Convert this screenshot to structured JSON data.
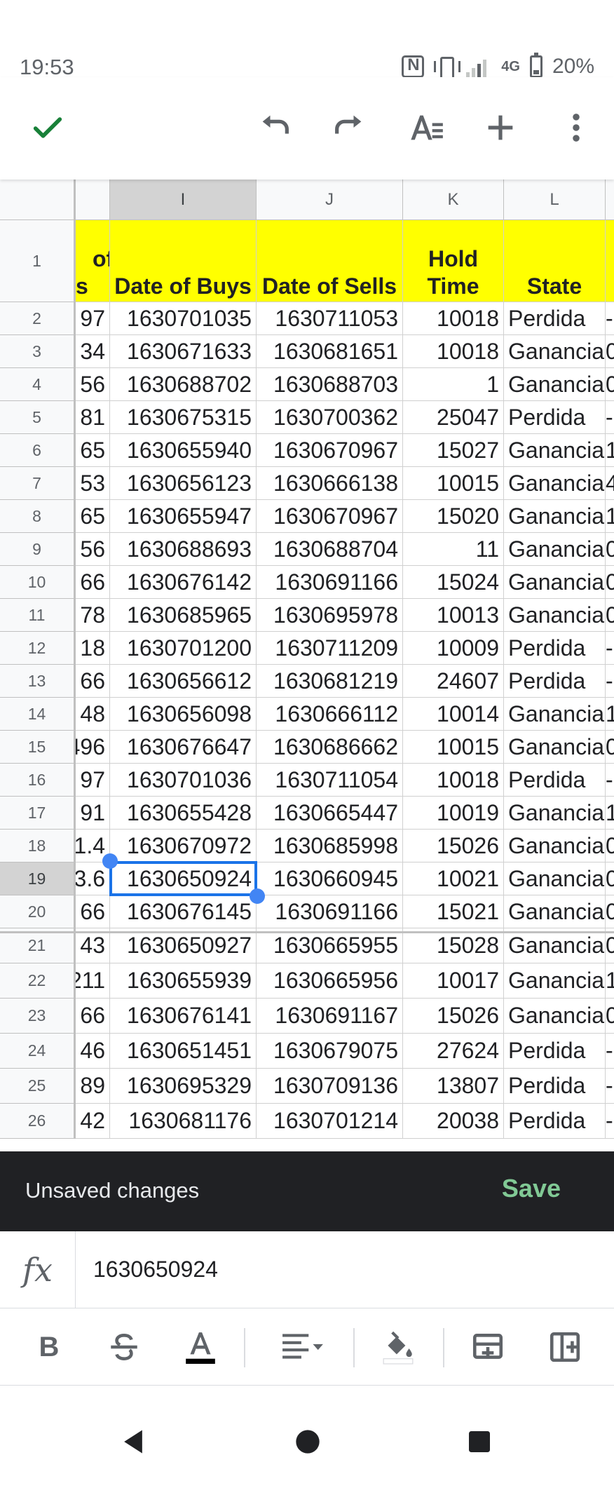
{
  "status": {
    "time": "19:53",
    "network": "4G",
    "battery": "20%"
  },
  "columns": [
    "I",
    "J",
    "K",
    "L"
  ],
  "header_row": {
    "row": "1",
    "h_partial_top": "of",
    "h_partial_bottom": "s",
    "i": "Date of Buys",
    "j": "Date of Sells",
    "k": "Hold Time",
    "l": "State"
  },
  "rows": [
    {
      "n": "2",
      "h": "97",
      "i": "1630701035",
      "j": "1630711053",
      "k": "10018",
      "l": "Perdida",
      "m": "-"
    },
    {
      "n": "3",
      "h": "34",
      "i": "1630671633",
      "j": "1630681651",
      "k": "10018",
      "l": "Ganancia",
      "m": "0"
    },
    {
      "n": "4",
      "h": "56",
      "i": "1630688702",
      "j": "1630688703",
      "k": "1",
      "l": "Ganancia",
      "m": "0"
    },
    {
      "n": "5",
      "h": "81",
      "i": "1630675315",
      "j": "1630700362",
      "k": "25047",
      "l": "Perdida",
      "m": "-"
    },
    {
      "n": "6",
      "h": "65",
      "i": "1630655940",
      "j": "1630670967",
      "k": "15027",
      "l": "Ganancia",
      "m": "1"
    },
    {
      "n": "7",
      "h": "53",
      "i": "1630656123",
      "j": "1630666138",
      "k": "10015",
      "l": "Ganancia",
      "m": "4"
    },
    {
      "n": "8",
      "h": "65",
      "i": "1630655947",
      "j": "1630670967",
      "k": "15020",
      "l": "Ganancia",
      "m": "1"
    },
    {
      "n": "9",
      "h": "56",
      "i": "1630688693",
      "j": "1630688704",
      "k": "11",
      "l": "Ganancia",
      "m": "0"
    },
    {
      "n": "10",
      "h": "66",
      "i": "1630676142",
      "j": "1630691166",
      "k": "15024",
      "l": "Ganancia",
      "m": "0"
    },
    {
      "n": "11",
      "h": "78",
      "i": "1630685965",
      "j": "1630695978",
      "k": "10013",
      "l": "Ganancia",
      "m": "0"
    },
    {
      "n": "12",
      "h": "18",
      "i": "1630701200",
      "j": "1630711209",
      "k": "10009",
      "l": "Perdida",
      "m": "-"
    },
    {
      "n": "13",
      "h": "66",
      "i": "1630656612",
      "j": "1630681219",
      "k": "24607",
      "l": "Perdida",
      "m": "-"
    },
    {
      "n": "14",
      "h": "48",
      "i": "1630656098",
      "j": "1630666112",
      "k": "10014",
      "l": "Ganancia",
      "m": "1"
    },
    {
      "n": "15",
      "h": "496",
      "i": "1630676647",
      "j": "1630686662",
      "k": "10015",
      "l": "Ganancia",
      "m": "0"
    },
    {
      "n": "16",
      "h": "97",
      "i": "1630701036",
      "j": "1630711054",
      "k": "10018",
      "l": "Perdida",
      "m": "-"
    },
    {
      "n": "17",
      "h": "91",
      "i": "1630655428",
      "j": "1630665447",
      "k": "10019",
      "l": "Ganancia",
      "m": "1"
    },
    {
      "n": "18",
      "h": "1.4",
      "i": "1630670972",
      "j": "1630685998",
      "k": "15026",
      "l": "Ganancia",
      "m": "0"
    },
    {
      "n": "19",
      "h": "3.6",
      "i": "1630650924",
      "j": "1630660945",
      "k": "10021",
      "l": "Ganancia",
      "m": "0"
    },
    {
      "n": "20",
      "h": "66",
      "i": "1630676145",
      "j": "1630691166",
      "k": "15021",
      "l": "Ganancia",
      "m": "0"
    },
    {
      "n": "21",
      "h": "43",
      "i": "1630650927",
      "j": "1630665955",
      "k": "15028",
      "l": "Ganancia",
      "m": "0"
    },
    {
      "n": "22",
      "h": "211",
      "i": "1630655939",
      "j": "1630665956",
      "k": "10017",
      "l": "Ganancia",
      "m": "1"
    },
    {
      "n": "23",
      "h": "66",
      "i": "1630676141",
      "j": "1630691167",
      "k": "15026",
      "l": "Ganancia",
      "m": "0"
    },
    {
      "n": "24",
      "h": "46",
      "i": "1630651451",
      "j": "1630679075",
      "k": "27624",
      "l": "Perdida",
      "m": "-"
    },
    {
      "n": "25",
      "h": "89",
      "i": "1630695329",
      "j": "1630709136",
      "k": "13807",
      "l": "Perdida",
      "m": "-"
    },
    {
      "n": "26",
      "h": "42",
      "i": "1630681176",
      "j": "1630701214",
      "k": "20038",
      "l": "Perdida",
      "m": "-"
    }
  ],
  "selected_row": "19",
  "selected_column": "I",
  "snackbar": {
    "message": "Unsaved changes",
    "action": "Save"
  },
  "formula_bar": {
    "fx": "fx",
    "value": "1630650924"
  },
  "format_toolbar": {
    "bold": "B"
  },
  "colors": {
    "header_fill": "#ffff00",
    "selection": "#1a73e8",
    "accept": "#188038",
    "save": "#81c995"
  }
}
